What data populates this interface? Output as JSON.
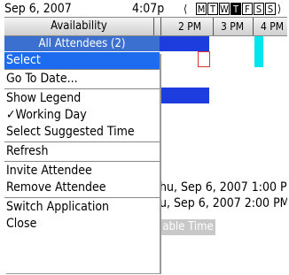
{
  "status": {
    "date": "Sep 6, 2007",
    "time": "4:07p",
    "days": [
      "M",
      "T",
      "W",
      "T",
      "F",
      "S",
      "S"
    ],
    "selected_day_index": 3
  },
  "header": {
    "availability": "Availability",
    "times": [
      "2 PM",
      "3 PM",
      "4 PM"
    ]
  },
  "attendees_label": "All Attendees (2)",
  "menu": {
    "items": [
      {
        "label": "Select",
        "highlighted": true
      },
      {
        "label": "Go To Date..."
      },
      {
        "label": "Show Legend"
      },
      {
        "label": "✓Working Day"
      },
      {
        "label": "Select Suggested Time"
      },
      {
        "label": "Refresh"
      },
      {
        "label": "Invite Attendee"
      },
      {
        "label": "Remove Attendee"
      },
      {
        "label": "Switch Application"
      },
      {
        "label": "Close"
      }
    ]
  },
  "details": {
    "start": "hu, Sep 6, 2007 1:00 PM",
    "end": "u, Sep 6, 2007 2:00 PM",
    "button": "able Time"
  },
  "colors": {
    "highlight": "#1d6cf0",
    "busy": "#1e3dde",
    "tentative": "#00e5ee",
    "selection": "#e03030"
  }
}
